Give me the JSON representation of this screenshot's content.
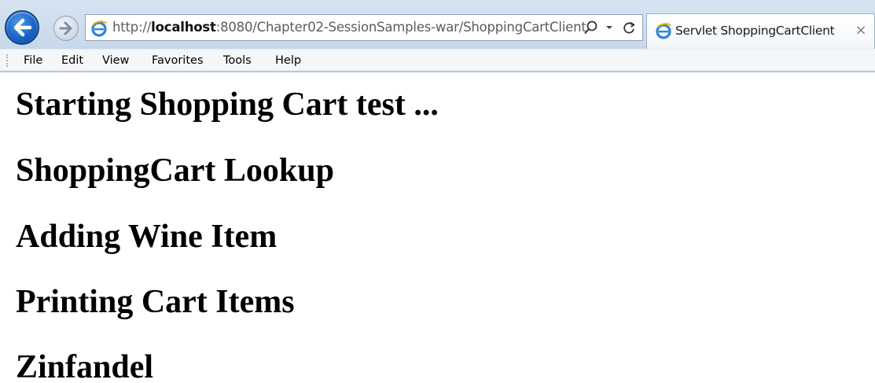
{
  "browser": {
    "address": {
      "url_prefix": "http://",
      "url_host": "localhost",
      "url_rest": ":8080/Chapter02-SessionSamples-war/ShoppingCartClient"
    },
    "tab": {
      "title": "Servlet ShoppingCartClient",
      "close_glyph": "×"
    },
    "menu": [
      "File",
      "Edit",
      "View",
      "Favorites",
      "Tools",
      "Help"
    ],
    "icons": {
      "back": "back-arrow-icon",
      "forward": "forward-arrow-icon",
      "page": "internet-explorer-icon",
      "search": "search-icon",
      "dropdown": "chevron-down-icon",
      "refresh": "refresh-icon",
      "close": "close-icon"
    },
    "colors": {
      "accent_blue": "#1a63c4",
      "chrome_bg": "#d6e4f2"
    }
  },
  "page": {
    "headings": [
      "Starting Shopping Cart test ...",
      "ShoppingCart Lookup",
      "Adding Wine Item",
      "Printing Cart Items",
      "Zinfandel"
    ]
  }
}
